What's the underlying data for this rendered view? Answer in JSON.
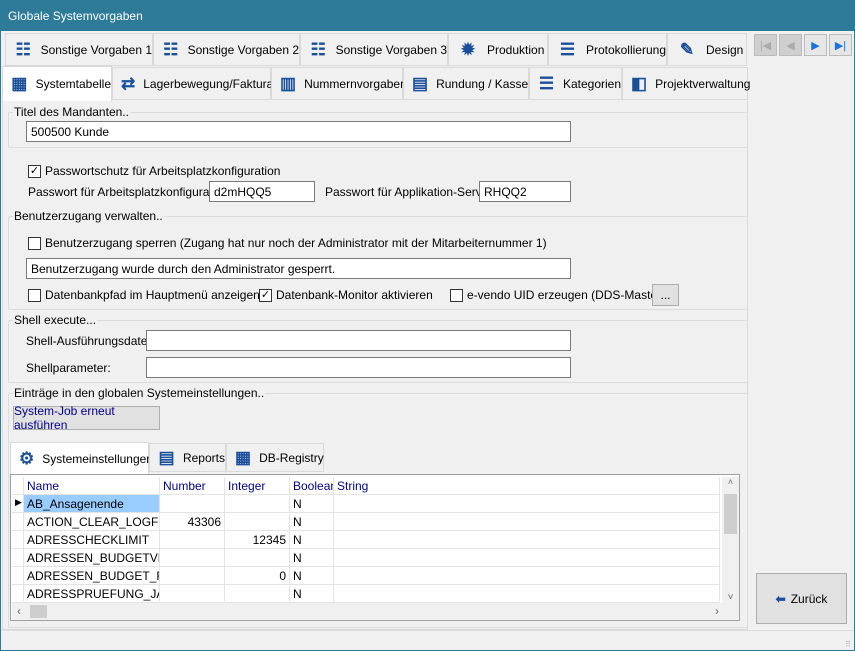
{
  "window": {
    "title": "Globale Systemvorgaben"
  },
  "tabs_row1": [
    {
      "label": "Sonstige Vorgaben 1",
      "icon": "form-icon"
    },
    {
      "label": "Sonstige Vorgaben 2",
      "icon": "form-icon"
    },
    {
      "label": "Sonstige Vorgaben 3",
      "icon": "form-icon"
    },
    {
      "label": "Produktion",
      "icon": "gear-icon"
    },
    {
      "label": "Protokollierung",
      "icon": "list-icon"
    },
    {
      "label": "Design",
      "icon": "design-icon"
    }
  ],
  "tabs_row2": [
    {
      "label": "Systemtabelle",
      "icon": "table-icon",
      "active": true
    },
    {
      "label": "Lagerbewegung/Faktura",
      "icon": "arrows-icon"
    },
    {
      "label": "Nummernvorgaben",
      "icon": "barcode-icon"
    },
    {
      "label": "Rundung / Kasse",
      "icon": "cash-register-icon"
    },
    {
      "label": "Kategorien",
      "icon": "chat-icon"
    },
    {
      "label": "Projektverwaltung",
      "icon": "windows-icon"
    }
  ],
  "nav": {
    "first": "|◀",
    "prev": "◀",
    "next": "▶",
    "last": "▶|"
  },
  "mandant": {
    "group": "Titel des Mandanten..",
    "value": "500500 Kunde"
  },
  "password": {
    "checkbox": "Passwortschutz für Arbeitsplatzkonfiguration",
    "checked": true,
    "ws_label": "Passwort für Arbeitsplatzkonfiguration:",
    "ws_value": "d2mHQQ5",
    "app_label": "Passwort für Applikation-Server:",
    "app_value": "RHQQ2"
  },
  "access": {
    "group": "Benutzerzugang verwalten..",
    "lock_label": "Benutzerzugang sperren (Zugang hat nur noch der Administrator mit der Mitarbeiternummer 1)",
    "lock_checked": false,
    "message": "Benutzerzugang wurde durch den Administrator gesperrt.",
    "dbpath_label": "Datenbankpfad im Hauptmenü anzeigen",
    "dbpath_checked": false,
    "monitor_label": "Datenbank-Monitor aktivieren",
    "monitor_checked": true,
    "uid_label": "e-vendo UID erzeugen (DDS-Master)",
    "uid_checked": false,
    "more_button": "..."
  },
  "shell": {
    "group": "Shell execute...",
    "file_label": "Shell-Ausführungsdatei:",
    "file_value": "",
    "param_label": "Shellparameter:",
    "param_value": ""
  },
  "entries": {
    "group": "Einträge in den globalen Systemeinstellungen..",
    "job_button": "System-Job erneut ausführen",
    "tabs": [
      {
        "label": "Systemeinstellungen",
        "icon": "gears-icon",
        "active": true
      },
      {
        "label": "Reports",
        "icon": "report-icon"
      },
      {
        "label": "DB-Registry",
        "icon": "table-icon"
      }
    ],
    "columns": [
      "Name",
      "Number",
      "Integer",
      "Boolean",
      "String"
    ],
    "rows": [
      [
        "AB_Ansagenende",
        "",
        "",
        "N",
        ""
      ],
      [
        "ACTION_CLEAR_LOGFILE",
        "43306",
        "",
        "N",
        ""
      ],
      [
        "ADRESSCHECKLIMIT",
        "",
        "12345",
        "N",
        ""
      ],
      [
        "ADRESSEN_BUDGETVER",
        "",
        "",
        "N",
        ""
      ],
      [
        "ADRESSEN_BUDGET_RE",
        "",
        "0",
        "N",
        ""
      ],
      [
        "ADRESSPRUEFUNG_JANI",
        "",
        "",
        "N",
        ""
      ]
    ]
  },
  "back_button": "Zurück",
  "colors": {
    "titlebar": "#2e7b99",
    "icon": "#1a4f9c",
    "selected": "#99ccff",
    "header_text": "#00008b"
  }
}
